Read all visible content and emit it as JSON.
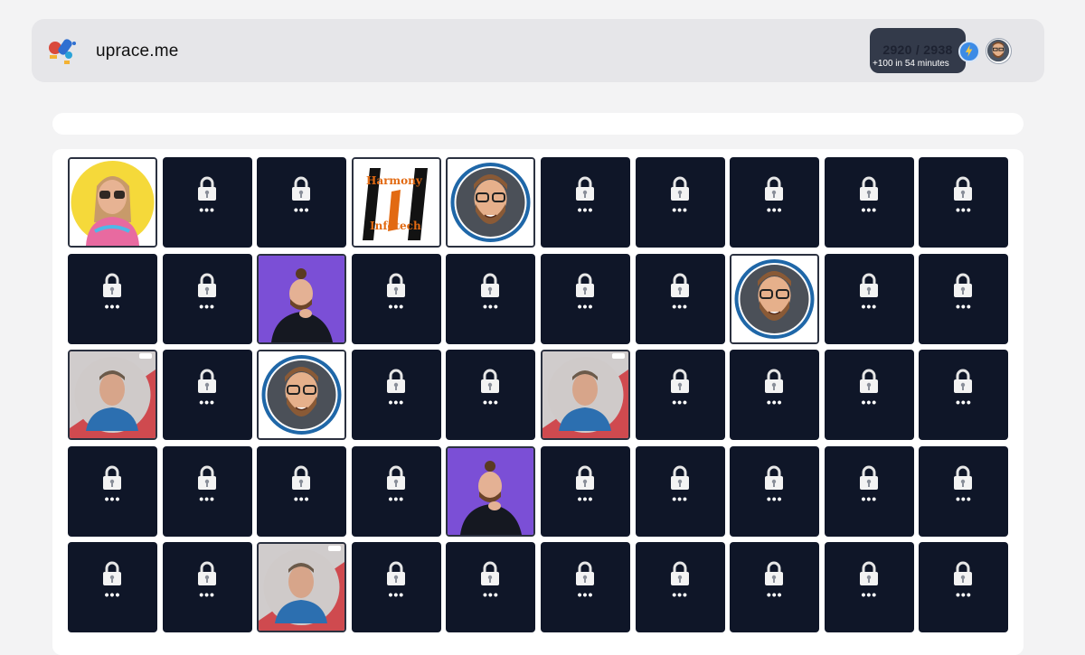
{
  "header": {
    "brand": "uprace.me",
    "score": "2920 / 2938",
    "score_sub": "+100 in 54 minutes",
    "icons": [
      "rocket-logo-icon",
      "lightning-icon",
      "user-avatar"
    ]
  },
  "grid": {
    "locked_dots": "•••",
    "rows": [
      [
        "photo-woman-yellow",
        "locked",
        "locked",
        "logo-harmony",
        "avatar-memoji",
        "locked",
        "locked",
        "locked",
        "locked",
        "locked"
      ],
      [
        "locked",
        "locked",
        "photo-man-purple",
        "locked",
        "locked",
        "locked",
        "locked",
        "avatar-memoji",
        "locked",
        "locked"
      ],
      [
        "photo-man-red",
        "locked",
        "avatar-memoji",
        "locked",
        "locked",
        "photo-man-red",
        "locked",
        "locked",
        "locked",
        "locked"
      ],
      [
        "locked",
        "locked",
        "locked",
        "locked",
        "photo-man-purple",
        "locked",
        "locked",
        "locked",
        "locked",
        "locked"
      ],
      [
        "locked",
        "locked",
        "photo-man-red",
        "locked",
        "locked",
        "locked",
        "locked",
        "locked",
        "locked",
        "locked"
      ]
    ],
    "harmony_logo": {
      "top": "Harmony",
      "bottom": "Infotech"
    }
  },
  "colors": {
    "tile_locked": "#0f1628",
    "memoji_ring": "#1f67a8",
    "purple_bg": "#7b4fd6",
    "red_bg": "#cf4a4f",
    "yellow_bg": "#f5d93a"
  }
}
